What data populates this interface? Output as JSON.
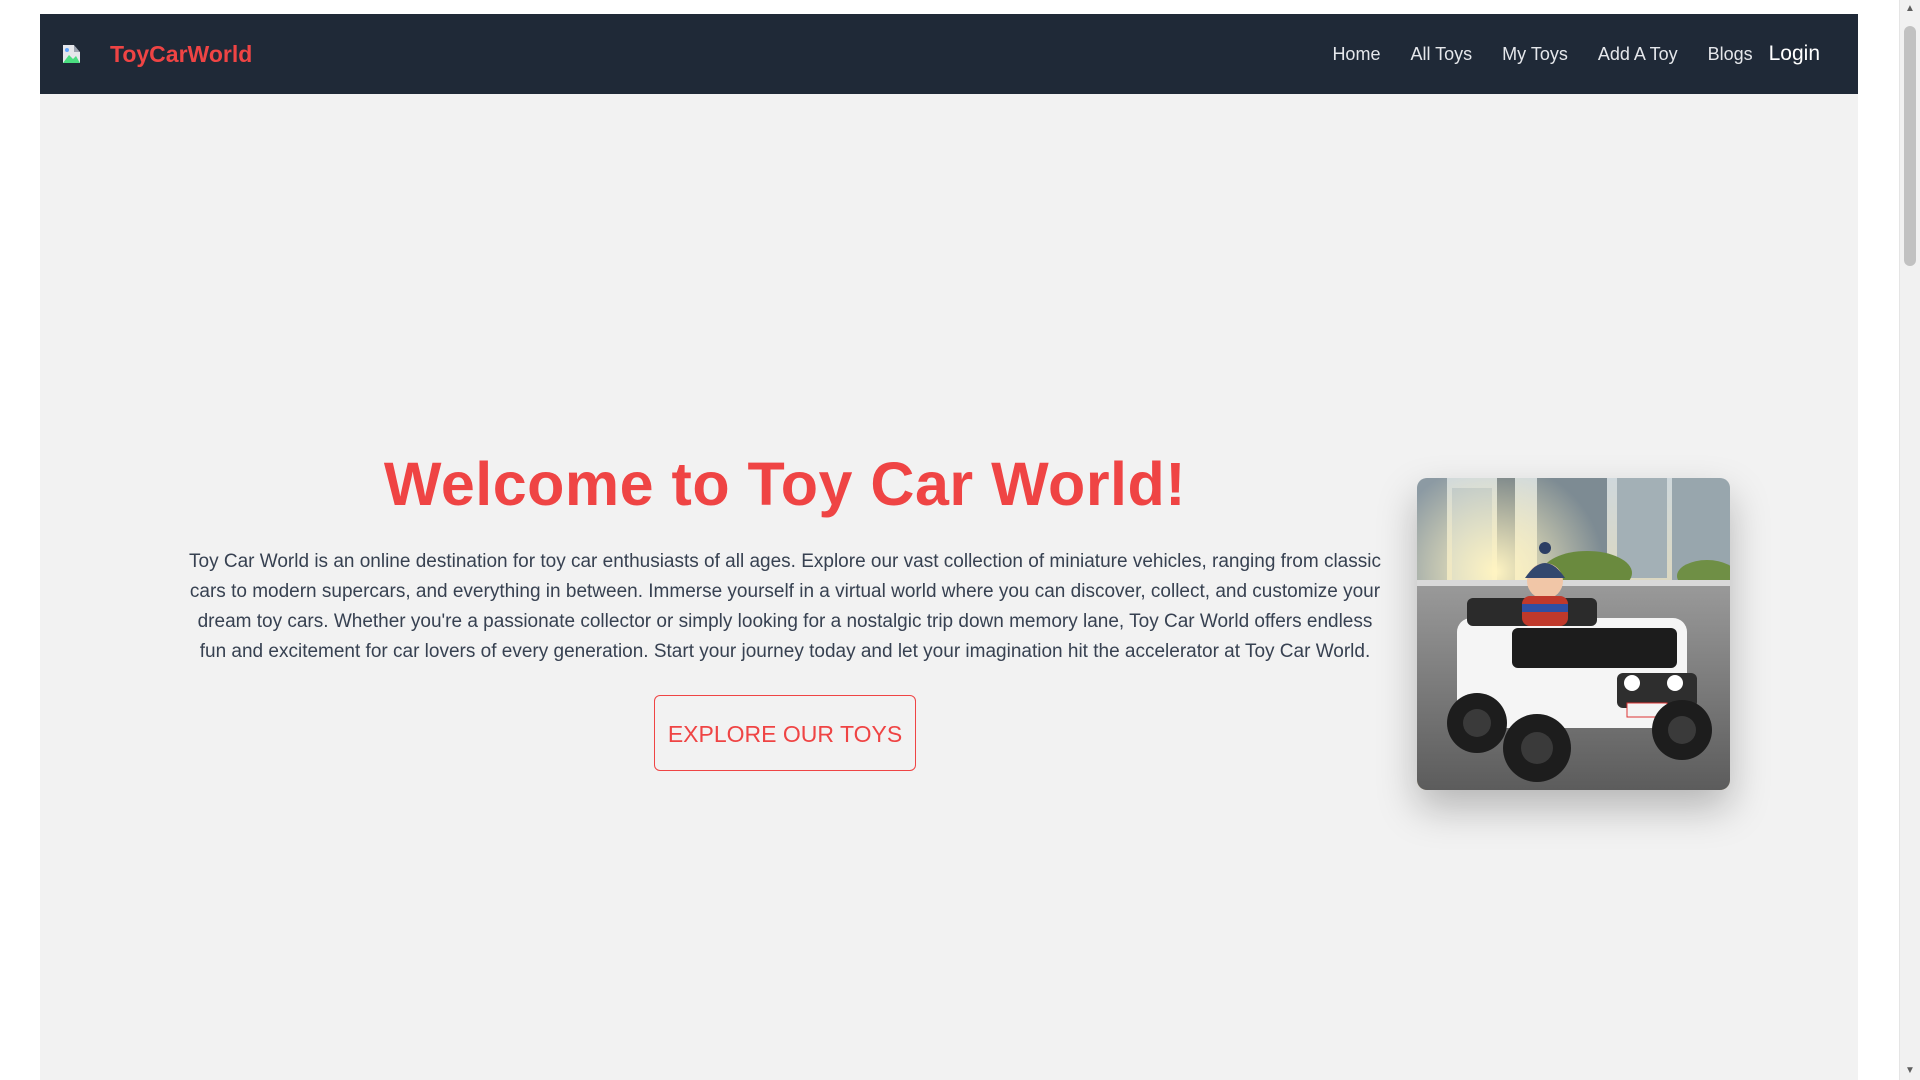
{
  "navbar": {
    "brand_name": "ToyCarWorld",
    "links": [
      "Home",
      "All Toys",
      "My Toys",
      "Add A Toy",
      "Blogs"
    ],
    "login_label": "Login",
    "logo_icon": "broken-image-icon"
  },
  "hero": {
    "title": "Welcome to Toy Car World!",
    "description": "Toy Car World is an online destination for toy car enthusiasts of all ages. Explore our vast collection of miniature vehicles, ranging from classic cars to modern supercars, and everything in between. Immerse yourself in a virtual world where you can discover, collect, and customize your dream toy cars. Whether you're a passionate collector or simply looking for a nostalgic trip down memory lane, Toy Car World offers endless fun and excitement for car lovers of every generation. Start your journey today and let your imagination hit the accelerator at Toy Car World.",
    "cta_label": "EXPLORE OUR TOYS",
    "image_icon": "kid-ride-on-jeep-image"
  },
  "colors": {
    "accent": "#ef4444",
    "navbar_bg": "#1f2937",
    "page_bg": "#f2f2f2",
    "text": "#374151"
  },
  "scrollbar": {
    "up_icon": "scroll-up-arrow-icon",
    "down_icon": "scroll-down-arrow-icon"
  }
}
